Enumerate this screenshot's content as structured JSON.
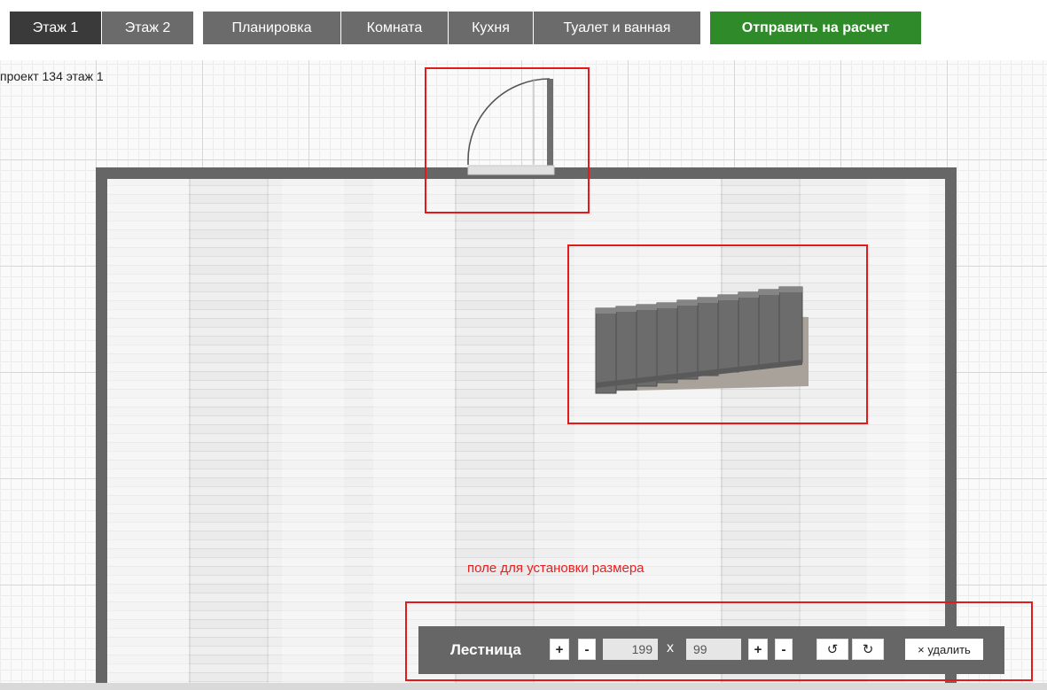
{
  "tabs": {
    "floor1": "Этаж 1",
    "floor2": "Этаж 2",
    "layout": "Планировка",
    "room": "Комната",
    "kitchen": "Кухня",
    "bathroom": "Туалет и ванная",
    "submit": "Отправить на расчет"
  },
  "canvas": {
    "project_label": "проект 134 этаж 1",
    "hint": "поле для установки размера"
  },
  "panel": {
    "title": "Лестница",
    "plus": "+",
    "minus": "-",
    "width_value": "199",
    "times": "x",
    "depth_value": "99",
    "rotate_ccw": "↺",
    "rotate_cw": "↻",
    "delete_label": "× удалить"
  },
  "colors": {
    "tab_active": "#3a3a3a",
    "tab_inactive": "#6b6b6b",
    "submit": "#2f8a2a",
    "highlight": "#e41a1a",
    "wall": "#666666"
  },
  "icons": {
    "rotate_ccw": "rotate-left-icon",
    "rotate_cw": "rotate-right-icon",
    "delete": "close-icon"
  }
}
